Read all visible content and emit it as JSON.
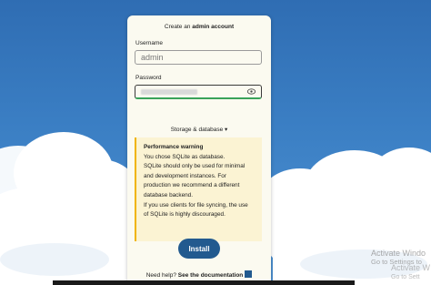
{
  "header": {
    "prefix": "Create an",
    "bold": "admin account"
  },
  "username": {
    "label": "Username",
    "value": "admin"
  },
  "password": {
    "label": "Password",
    "icon": "eye-icon"
  },
  "storage": {
    "label": "Storage & database ▾"
  },
  "warning": {
    "title": "Performance warning",
    "lines": [
      "You chose SQLite as database.",
      "SQLite should only be used for minimal",
      "and development instances. For",
      "production we recommend a different",
      "database backend.",
      "If you use clients for file syncing, the use",
      "of SQLite is highly discouraged."
    ]
  },
  "install": {
    "label": "Install"
  },
  "help": {
    "prefix": "Need help?",
    "link": "See the documentation",
    "icon": "external-link-icon"
  },
  "watermark": {
    "line1": "Activate Windo",
    "line2": "Go to Settings to",
    "line3": "Activate W",
    "line4": "Go to Sett"
  },
  "colors": {
    "sky": "#3b7fc4",
    "card": "#fbfaf0",
    "accent": "#225a8f",
    "warning_bg": "#fbf3d3",
    "warning_border": "#f0b400",
    "success": "#3aa35a"
  }
}
